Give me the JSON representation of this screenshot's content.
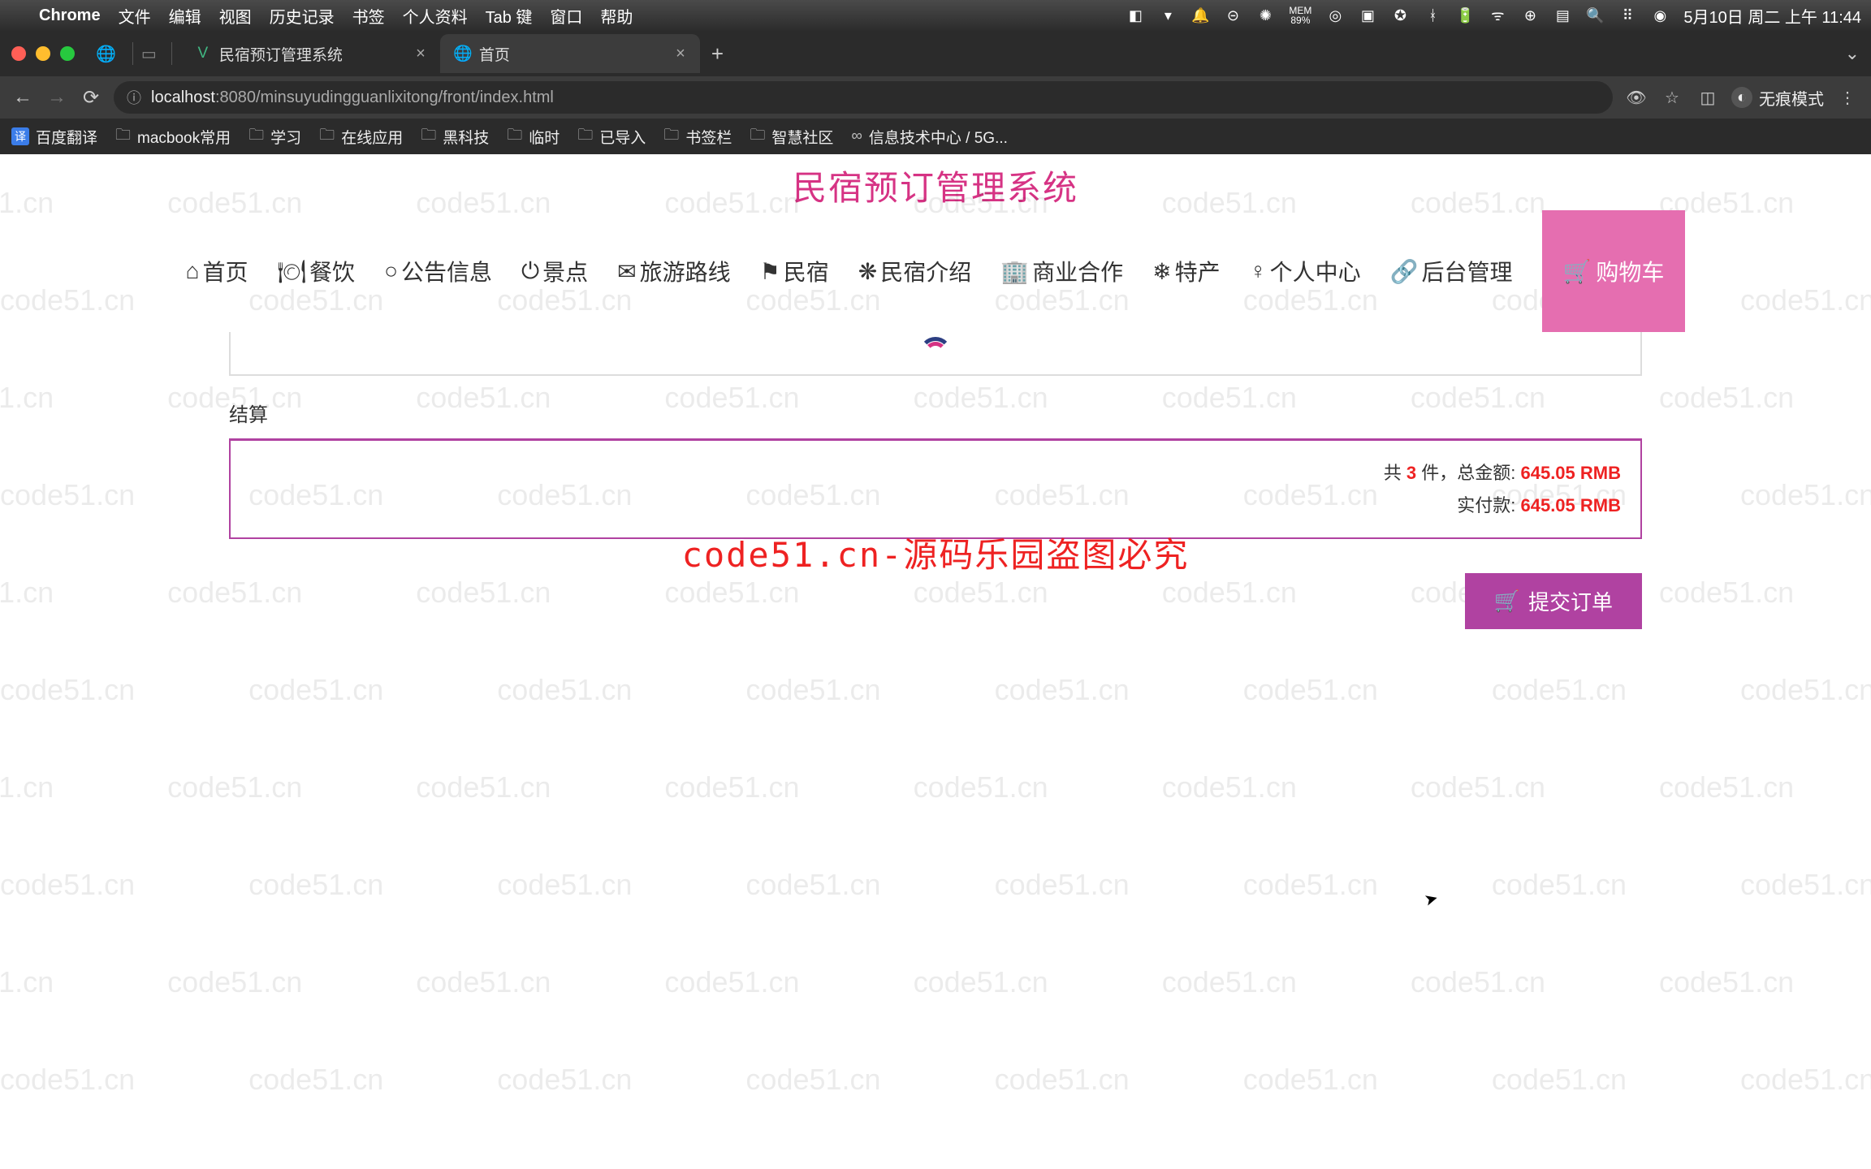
{
  "menubar": {
    "app": "Chrome",
    "items": [
      "文件",
      "编辑",
      "视图",
      "历史记录",
      "书签",
      "个人资料",
      "Tab 键",
      "窗口",
      "帮助"
    ],
    "mem_label": "MEM",
    "mem_val": "89%",
    "clock": "5月10日 周二 上午 11:44"
  },
  "tabs": {
    "t1": "民宿预订管理系统",
    "t2": "首页"
  },
  "address": {
    "host": "localhost",
    "port": ":8080",
    "path": "/minsuyudingguanlixitong/front/index.html"
  },
  "incognito": "无痕模式",
  "bookmarks": {
    "b0": "百度翻译",
    "b1": "macbook常用",
    "b2": "学习",
    "b3": "在线应用",
    "b4": "黑科技",
    "b5": "临时",
    "b6": "已导入",
    "b7": "书签栏",
    "b8": "智慧社区",
    "b9": "信息技术中心 / 5G..."
  },
  "page": {
    "title": "民宿预订管理系统",
    "nav": {
      "home": "首页",
      "food": "餐饮",
      "notice": "公告信息",
      "spot": "景点",
      "route": "旅游路线",
      "lodge": "民宿",
      "intro": "民宿介绍",
      "biz": "商业合作",
      "spec": "特产",
      "personal": "个人中心",
      "admin": "后台管理",
      "cart": "购物车"
    },
    "checkout_title": "结算",
    "summary": {
      "prefix": "共 ",
      "count": "3",
      "mid": " 件，总金额: ",
      "total": "645.05 RMB",
      "pay_label": "实付款: ",
      "pay": "645.05 RMB"
    },
    "submit": "提交订单",
    "watermark": "code51.cn",
    "banner": "code51.cn-源码乐园盗图必究"
  }
}
